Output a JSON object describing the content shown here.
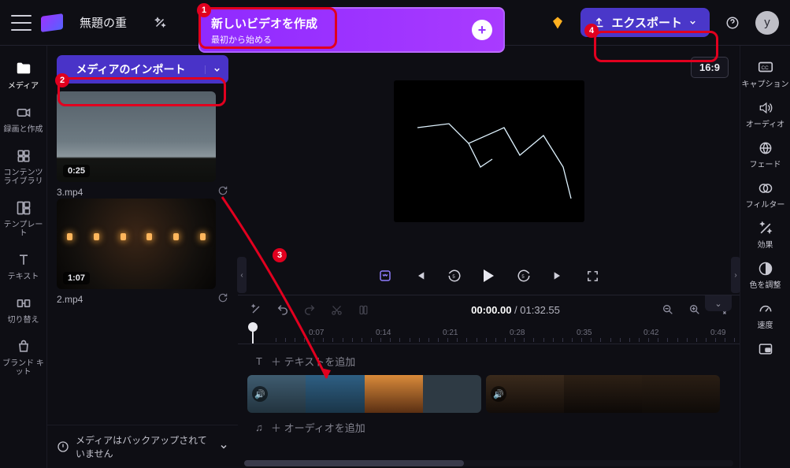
{
  "header": {
    "project_title": "無題の重",
    "premium_icon": "diamond-icon",
    "export_label": "エクスポート",
    "avatar_letter": "y"
  },
  "new_video": {
    "title": "新しいビデオを作成",
    "subtitle": "最初から始める"
  },
  "left_nav": [
    {
      "name": "media",
      "label": "メディア",
      "active": true,
      "icon": "folder-icon"
    },
    {
      "name": "record",
      "label": "録画と作成",
      "icon": "camera-icon"
    },
    {
      "name": "contentlib",
      "label": "コンテンツ ライブラリ",
      "icon": "stack-icon"
    },
    {
      "name": "template",
      "label": "テンプレート",
      "icon": "grid-icon"
    },
    {
      "name": "text",
      "label": "テキスト",
      "icon": "text-icon"
    },
    {
      "name": "transition",
      "label": "切り替え",
      "icon": "transition-icon"
    },
    {
      "name": "brand",
      "label": "ブランド キット",
      "icon": "bag-icon"
    }
  ],
  "right_nav": [
    {
      "name": "caption",
      "label": "キャプション",
      "icon": "cc-icon"
    },
    {
      "name": "audio",
      "label": "オーディオ",
      "icon": "speaker-icon"
    },
    {
      "name": "fade",
      "label": "フェード",
      "icon": "globe-icon"
    },
    {
      "name": "filter",
      "label": "フィルター",
      "icon": "circles-icon"
    },
    {
      "name": "effect",
      "label": "効果",
      "icon": "wand-icon"
    },
    {
      "name": "color",
      "label": "色を調整",
      "icon": "contrast-icon"
    },
    {
      "name": "speed",
      "label": "速度",
      "icon": "gauge-icon"
    },
    {
      "name": "pip",
      "label": "",
      "icon": "pip-icon"
    }
  ],
  "media_panel": {
    "import_label": "メディアのインポート",
    "clips": [
      {
        "filename": "3.mp4",
        "duration": "0:25",
        "thumb": "storm"
      },
      {
        "filename": "2.mp4",
        "duration": "1:07",
        "thumb": "night"
      }
    ],
    "backup_msg": "メディアはバックアップされていません"
  },
  "preview": {
    "aspect_label": "16:9"
  },
  "timeline": {
    "current": "00:00.00",
    "total": "01:32.55",
    "separator": " / ",
    "ruler": [
      "0:07",
      "0:14",
      "0:21",
      "0:28",
      "0:35",
      "0:42",
      "0:49"
    ],
    "add_text": "＋ テキストを追加",
    "add_audio": "＋ オーディオを追加"
  },
  "annotations": {
    "a1": "1",
    "a2": "2",
    "a3": "3",
    "a4": "4"
  }
}
